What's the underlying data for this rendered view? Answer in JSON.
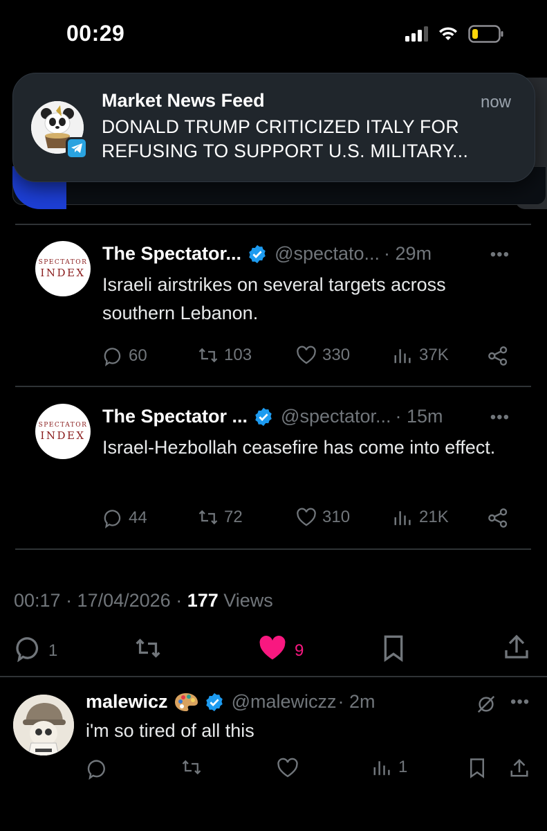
{
  "status_bar": {
    "time": "00:29"
  },
  "notification": {
    "app_name": "Market News Feed",
    "time": "now",
    "body": "DONALD TRUMP CRITICIZED ITALY FOR REFUSING TO SUPPORT U.S. MILITARY...",
    "badge_icon": "telegram-icon",
    "avatar_icon": "panda-avatar"
  },
  "quoted_tweets": [
    {
      "avatar_line1": "SPECTATOR",
      "avatar_line2": "INDEX",
      "name": "The Spectator...",
      "handle": "@spectato...",
      "time": "· 29m",
      "text": "Israeli airstrikes on several targets across southern Lebanon.",
      "replies": "60",
      "reposts": "103",
      "likes": "330",
      "views": "37K"
    },
    {
      "avatar_line1": "SPECTATOR",
      "avatar_line2": "INDEX",
      "name": "The Spectator ...",
      "handle": "@spectator...",
      "time": "· 15m",
      "text": "Israel-Hezbollah ceasefire has come into effect.",
      "replies": "44",
      "reposts": "72",
      "likes": "310",
      "views": "21K"
    }
  ],
  "main_tweet": {
    "timestamp": "00:17 · 17/04/2026 · ",
    "views_count": "177",
    "views_label": " Views",
    "replies": "1",
    "likes": "9"
  },
  "reply": {
    "name": "malewicz",
    "handle": "@malewiczz",
    "time": "· 2m",
    "text": "i'm so tired of all this",
    "views": "1"
  },
  "colors": {
    "background": "#000000",
    "like_pink": "#f91880",
    "verified_blue": "#1d9bf0",
    "muted_gray": "#71767b"
  }
}
